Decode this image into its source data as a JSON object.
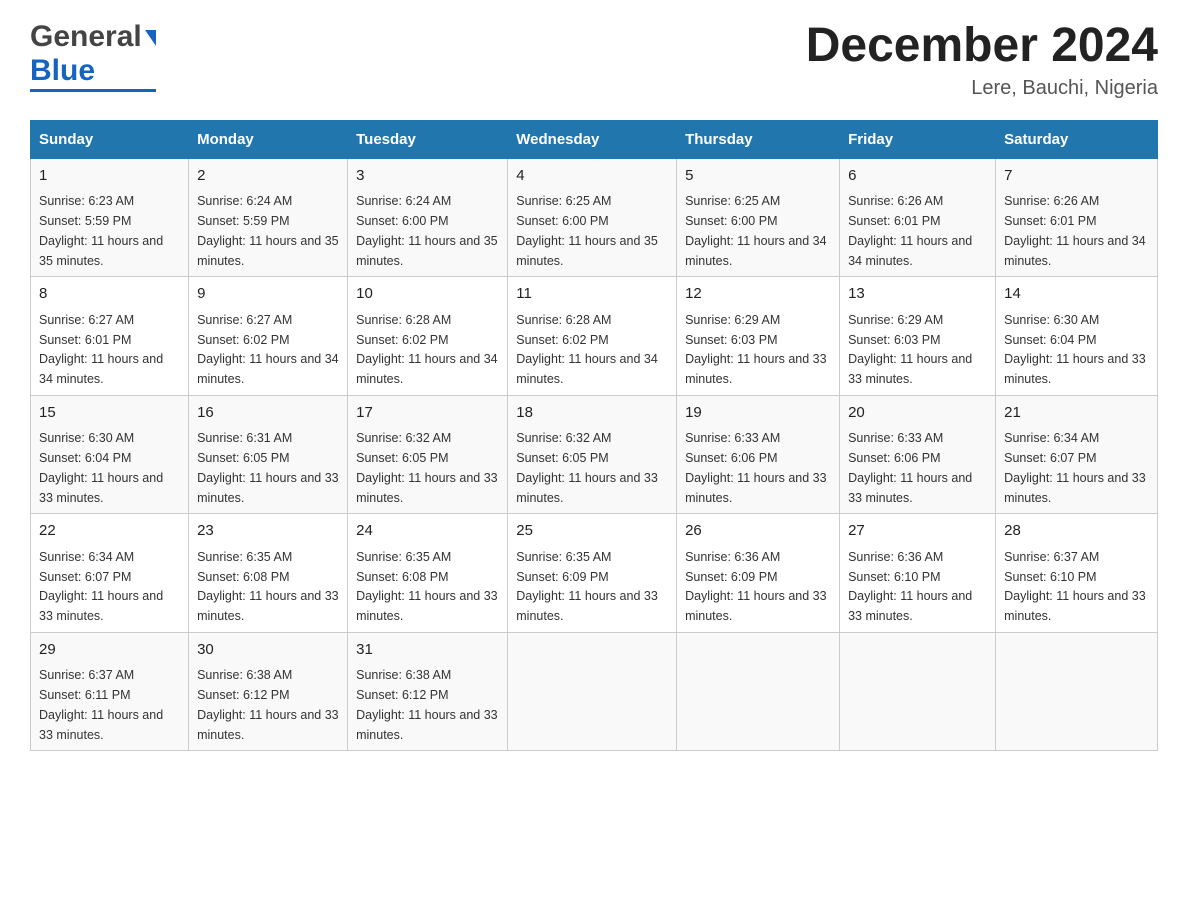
{
  "header": {
    "logo_general": "General",
    "logo_blue": "Blue",
    "main_title": "December 2024",
    "sub_title": "Lere, Bauchi, Nigeria"
  },
  "columns": [
    "Sunday",
    "Monday",
    "Tuesday",
    "Wednesday",
    "Thursday",
    "Friday",
    "Saturday"
  ],
  "weeks": [
    [
      {
        "day": "1",
        "sunrise": "6:23 AM",
        "sunset": "5:59 PM",
        "daylight": "11 hours and 35 minutes."
      },
      {
        "day": "2",
        "sunrise": "6:24 AM",
        "sunset": "5:59 PM",
        "daylight": "11 hours and 35 minutes."
      },
      {
        "day": "3",
        "sunrise": "6:24 AM",
        "sunset": "6:00 PM",
        "daylight": "11 hours and 35 minutes."
      },
      {
        "day": "4",
        "sunrise": "6:25 AM",
        "sunset": "6:00 PM",
        "daylight": "11 hours and 35 minutes."
      },
      {
        "day": "5",
        "sunrise": "6:25 AM",
        "sunset": "6:00 PM",
        "daylight": "11 hours and 34 minutes."
      },
      {
        "day": "6",
        "sunrise": "6:26 AM",
        "sunset": "6:01 PM",
        "daylight": "11 hours and 34 minutes."
      },
      {
        "day": "7",
        "sunrise": "6:26 AM",
        "sunset": "6:01 PM",
        "daylight": "11 hours and 34 minutes."
      }
    ],
    [
      {
        "day": "8",
        "sunrise": "6:27 AM",
        "sunset": "6:01 PM",
        "daylight": "11 hours and 34 minutes."
      },
      {
        "day": "9",
        "sunrise": "6:27 AM",
        "sunset": "6:02 PM",
        "daylight": "11 hours and 34 minutes."
      },
      {
        "day": "10",
        "sunrise": "6:28 AM",
        "sunset": "6:02 PM",
        "daylight": "11 hours and 34 minutes."
      },
      {
        "day": "11",
        "sunrise": "6:28 AM",
        "sunset": "6:02 PM",
        "daylight": "11 hours and 34 minutes."
      },
      {
        "day": "12",
        "sunrise": "6:29 AM",
        "sunset": "6:03 PM",
        "daylight": "11 hours and 33 minutes."
      },
      {
        "day": "13",
        "sunrise": "6:29 AM",
        "sunset": "6:03 PM",
        "daylight": "11 hours and 33 minutes."
      },
      {
        "day": "14",
        "sunrise": "6:30 AM",
        "sunset": "6:04 PM",
        "daylight": "11 hours and 33 minutes."
      }
    ],
    [
      {
        "day": "15",
        "sunrise": "6:30 AM",
        "sunset": "6:04 PM",
        "daylight": "11 hours and 33 minutes."
      },
      {
        "day": "16",
        "sunrise": "6:31 AM",
        "sunset": "6:05 PM",
        "daylight": "11 hours and 33 minutes."
      },
      {
        "day": "17",
        "sunrise": "6:32 AM",
        "sunset": "6:05 PM",
        "daylight": "11 hours and 33 minutes."
      },
      {
        "day": "18",
        "sunrise": "6:32 AM",
        "sunset": "6:05 PM",
        "daylight": "11 hours and 33 minutes."
      },
      {
        "day": "19",
        "sunrise": "6:33 AM",
        "sunset": "6:06 PM",
        "daylight": "11 hours and 33 minutes."
      },
      {
        "day": "20",
        "sunrise": "6:33 AM",
        "sunset": "6:06 PM",
        "daylight": "11 hours and 33 minutes."
      },
      {
        "day": "21",
        "sunrise": "6:34 AM",
        "sunset": "6:07 PM",
        "daylight": "11 hours and 33 minutes."
      }
    ],
    [
      {
        "day": "22",
        "sunrise": "6:34 AM",
        "sunset": "6:07 PM",
        "daylight": "11 hours and 33 minutes."
      },
      {
        "day": "23",
        "sunrise": "6:35 AM",
        "sunset": "6:08 PM",
        "daylight": "11 hours and 33 minutes."
      },
      {
        "day": "24",
        "sunrise": "6:35 AM",
        "sunset": "6:08 PM",
        "daylight": "11 hours and 33 minutes."
      },
      {
        "day": "25",
        "sunrise": "6:35 AM",
        "sunset": "6:09 PM",
        "daylight": "11 hours and 33 minutes."
      },
      {
        "day": "26",
        "sunrise": "6:36 AM",
        "sunset": "6:09 PM",
        "daylight": "11 hours and 33 minutes."
      },
      {
        "day": "27",
        "sunrise": "6:36 AM",
        "sunset": "6:10 PM",
        "daylight": "11 hours and 33 minutes."
      },
      {
        "day": "28",
        "sunrise": "6:37 AM",
        "sunset": "6:10 PM",
        "daylight": "11 hours and 33 minutes."
      }
    ],
    [
      {
        "day": "29",
        "sunrise": "6:37 AM",
        "sunset": "6:11 PM",
        "daylight": "11 hours and 33 minutes."
      },
      {
        "day": "30",
        "sunrise": "6:38 AM",
        "sunset": "6:12 PM",
        "daylight": "11 hours and 33 minutes."
      },
      {
        "day": "31",
        "sunrise": "6:38 AM",
        "sunset": "6:12 PM",
        "daylight": "11 hours and 33 minutes."
      },
      null,
      null,
      null,
      null
    ]
  ]
}
